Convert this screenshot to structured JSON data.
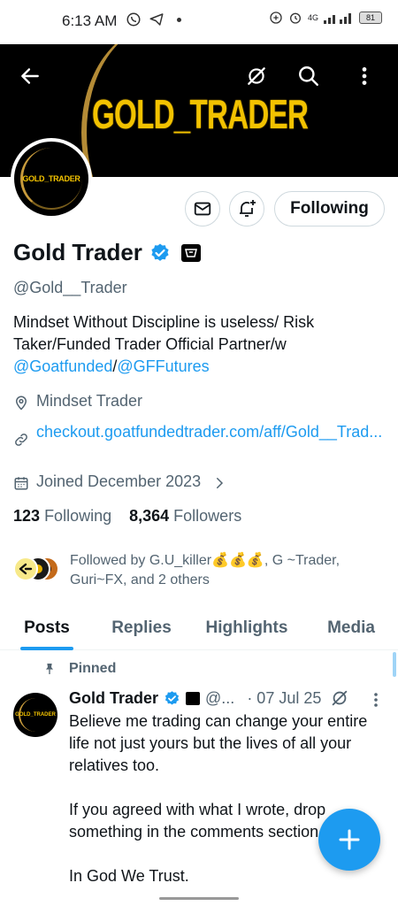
{
  "status_bar": {
    "time": "6:13 AM",
    "network": "4G",
    "battery": "81"
  },
  "banner": {
    "title": "GOLD_TRADER"
  },
  "avatar": {
    "text": "GOLD_TRADER"
  },
  "actions": {
    "following_label": "Following"
  },
  "profile": {
    "display_name": "Gold Trader",
    "handle": "@Gold__Trader",
    "bio_text": "Mindset Without Discipline is useless/ Risk Taker/Funded Trader Official Partner/w ",
    "bio_mention_1": "@Goatfunded",
    "bio_separator": "/",
    "bio_mention_2": "@GFFutures",
    "location": "Mindset Trader",
    "website": "checkout.goatfundedtrader.com/aff/Gold__Trad...",
    "joined": "Joined December 2023",
    "following_count": "123",
    "following_label": "Following",
    "followers_count": "8,364",
    "followers_label": "Followers",
    "followed_by": "Followed by G.U_killer💰💰💰, G ~Trader, Guri~FX, and 2 others"
  },
  "tabs": [
    {
      "label": "Posts"
    },
    {
      "label": "Replies"
    },
    {
      "label": "Highlights"
    },
    {
      "label": "Media"
    }
  ],
  "tweet": {
    "pinned_label": "Pinned",
    "author_name": "Gold Trader",
    "author_handle": "@...",
    "date": "· 07 Jul 25",
    "paragraph_1": "Believe me trading can change your entire life not just yours but the lives of all your relatives too.",
    "paragraph_2": "If you agreed with what I wrote, drop something in the comments section",
    "paragraph_3": "In God We Trust."
  },
  "colors": {
    "accent": "#1d9bf0",
    "gold": "#f2c200",
    "text": "#0f1419",
    "muted": "#536471"
  }
}
